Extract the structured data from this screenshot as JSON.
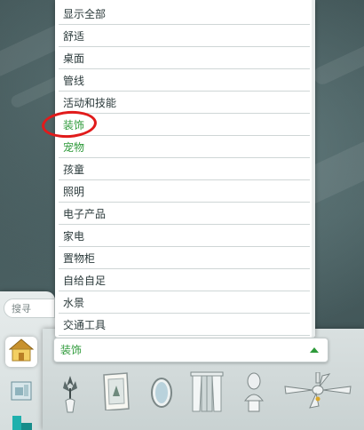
{
  "search": {
    "placeholder": "搜寻"
  },
  "category_list": {
    "items": [
      "显示全部",
      "舒适",
      "桌面",
      "管线",
      "活动和技能",
      "装饰",
      "宠物",
      "孩童",
      "照明",
      "电子产品",
      "家电",
      "置物柜",
      "自给自足",
      "水景",
      "交通工具"
    ],
    "selected_index": 5
  },
  "dropdown": {
    "selected_label": "装饰"
  },
  "side_tabs": [
    {
      "icon": "house-icon"
    },
    {
      "icon": "room-furniture-icon"
    },
    {
      "icon": "build-mode-icon"
    }
  ],
  "items": [
    {
      "icon": "plant-vase-icon"
    },
    {
      "icon": "framed-painting-icon"
    },
    {
      "icon": "oval-mirror-icon"
    },
    {
      "icon": "curtains-icon"
    },
    {
      "icon": "bust-sculpture-icon"
    },
    {
      "icon": "ceiling-fan-icon"
    }
  ],
  "colors": {
    "selected_text": "#2e9a3a",
    "highlight_ring": "#e11b1b"
  }
}
